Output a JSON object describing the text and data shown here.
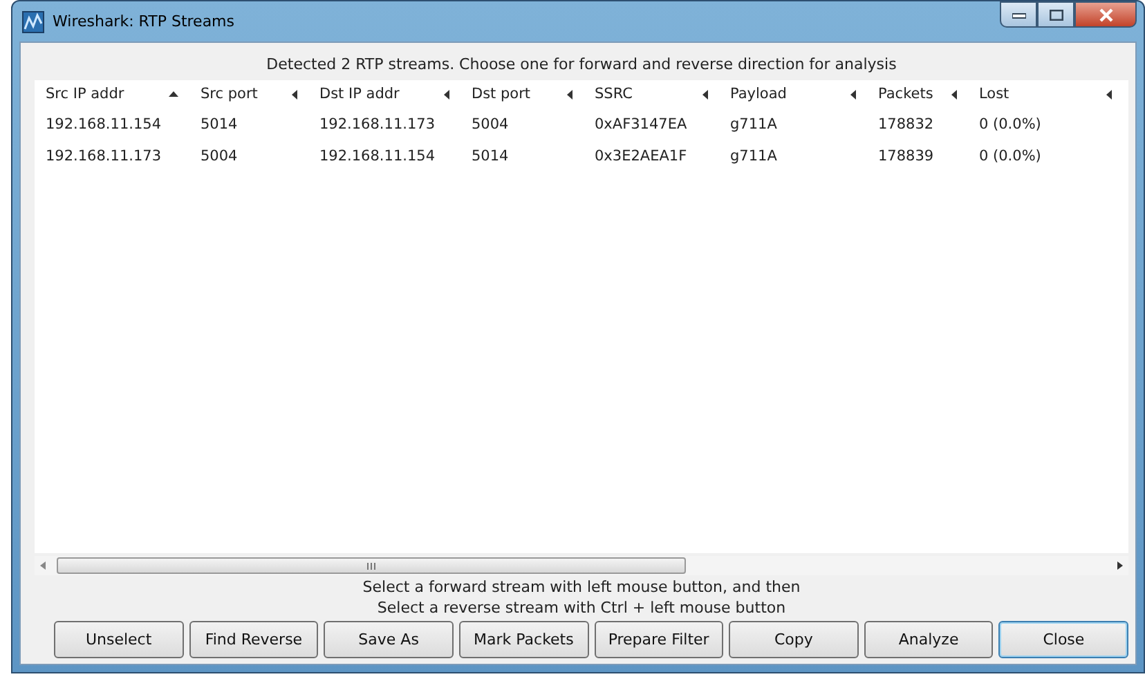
{
  "window": {
    "title": "Wireshark: RTP Streams"
  },
  "header_text": "Detected 2 RTP streams. Choose one for forward and reverse direction for analysis",
  "table": {
    "columns": [
      {
        "label": "Src IP addr",
        "sorted": true
      },
      {
        "label": "Src port",
        "sorted": false
      },
      {
        "label": "Dst IP addr",
        "sorted": false
      },
      {
        "label": "Dst port",
        "sorted": false
      },
      {
        "label": "SSRC",
        "sorted": false
      },
      {
        "label": "Payload",
        "sorted": false
      },
      {
        "label": "Packets",
        "sorted": false
      },
      {
        "label": "Lost",
        "sorted": false
      }
    ],
    "rows": [
      [
        "192.168.11.154",
        "5014",
        "192.168.11.173",
        "5004",
        "0xAF3147EA",
        "g711A",
        "178832",
        "0 (0.0%)"
      ],
      [
        "192.168.11.173",
        "5004",
        "192.168.11.154",
        "5014",
        "0x3E2AEA1F",
        "g711A",
        "178839",
        "0 (0.0%)"
      ]
    ]
  },
  "hint_lines": [
    "Select a forward stream with left mouse button, and then",
    "Select a reverse stream with Ctrl + left mouse button"
  ],
  "buttons": [
    {
      "label": "Unselect",
      "focused": false
    },
    {
      "label": "Find Reverse",
      "focused": false
    },
    {
      "label": "Save As",
      "focused": false
    },
    {
      "label": "Mark Packets",
      "focused": false
    },
    {
      "label": "Prepare Filter",
      "focused": false
    },
    {
      "label": "Copy",
      "focused": false
    },
    {
      "label": "Analyze",
      "focused": false
    },
    {
      "label": "Close",
      "focused": true
    }
  ]
}
